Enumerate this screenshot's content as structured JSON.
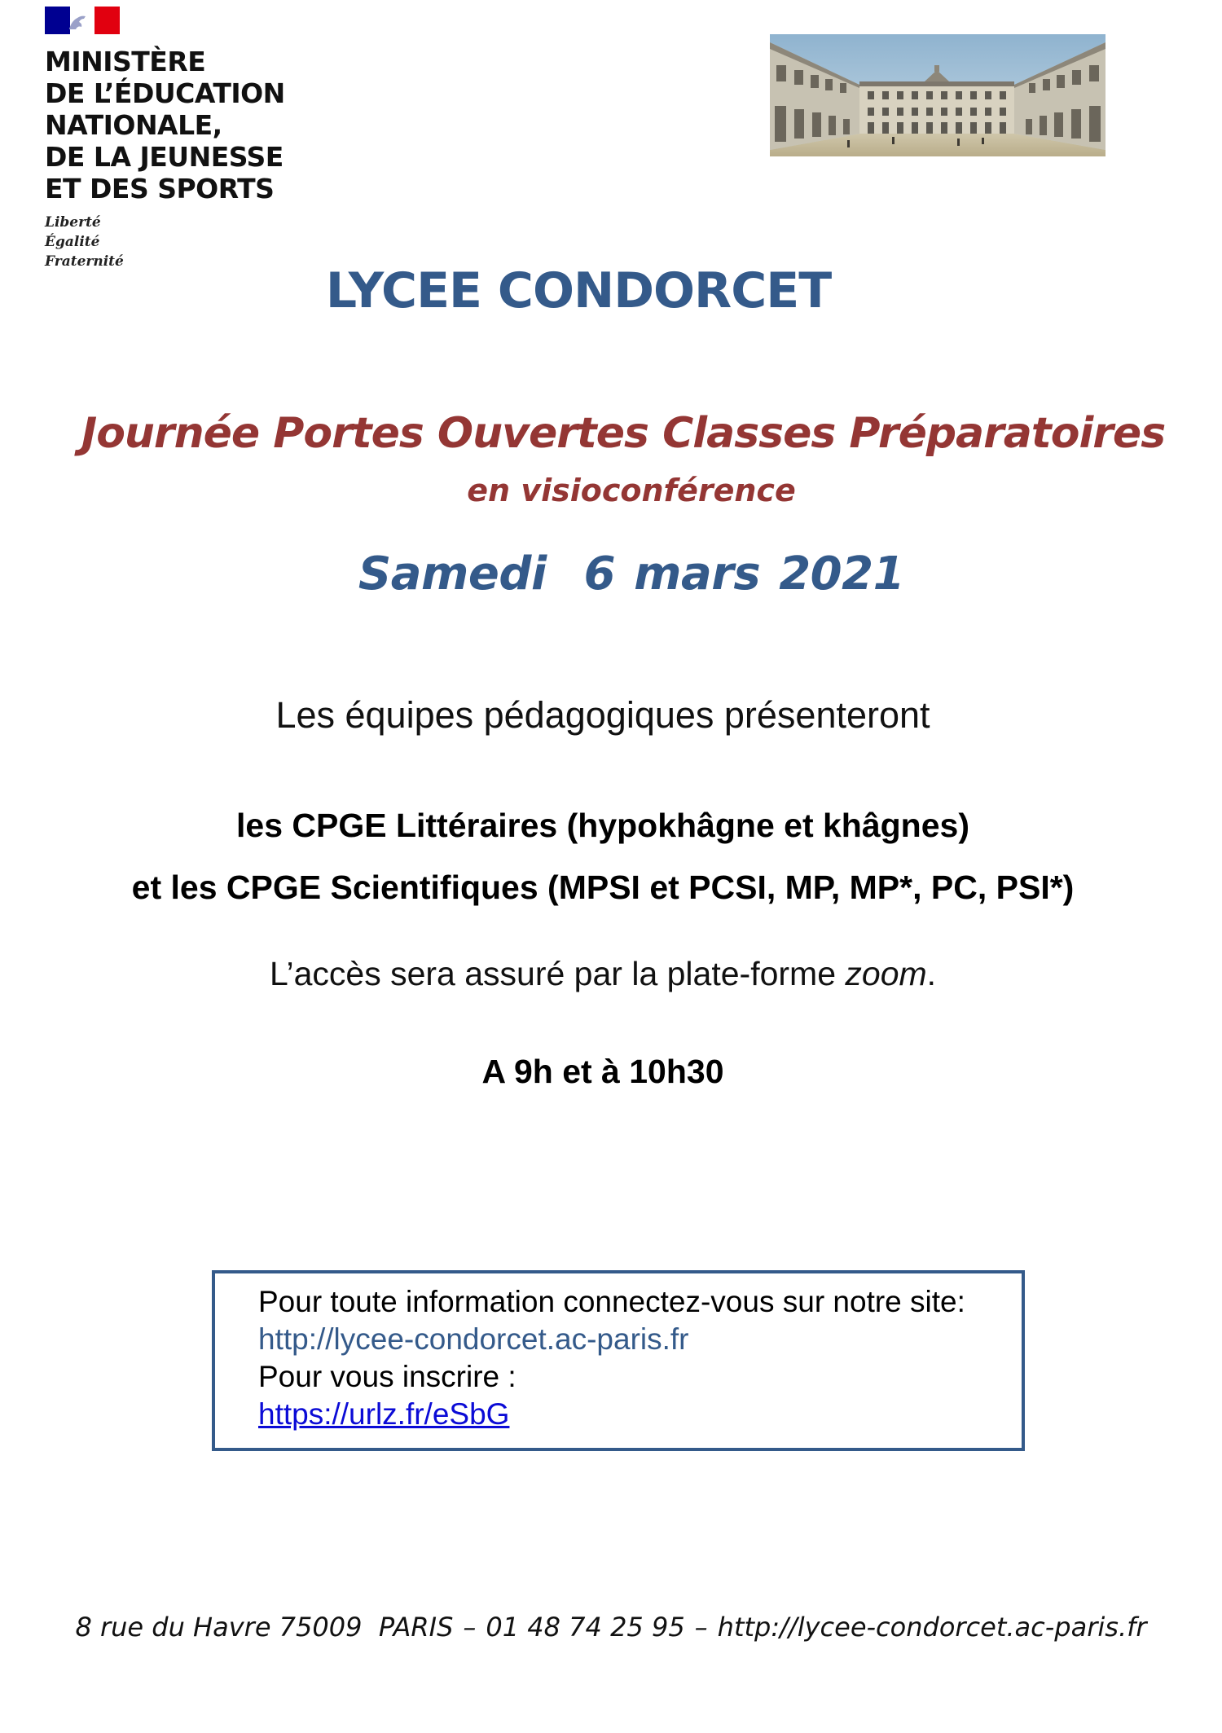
{
  "header": {
    "ministry_lines": [
      "MINISTÈRE",
      "DE L’ÉDUCATION",
      "NATIONALE,",
      "DE LA JEUNESSE",
      "ET DES SPORTS"
    ],
    "motto": [
      "Liberté",
      "Égalité",
      "Fraternité"
    ],
    "flag_colors": {
      "blue": "#000091",
      "white": "#ffffff",
      "red": "#e1000f"
    }
  },
  "title": {
    "school": "LYCEE CONDORCET",
    "event": "Journée Portes Ouvertes Classes Préparatoires",
    "format": "en visioconférence",
    "date": "Samedi  6 mars 2021"
  },
  "body": {
    "intro": "Les équipes pédagogiques présenteront",
    "cpge_literary": "les CPGE Littéraires (hypokhâgne et khâgnes)",
    "cpge_scientific": "et les CPGE Scientifiques (MPSI et PCSI, MP, MP*, PC, PSI*)",
    "access_before": "L’accès sera assuré par la plate-forme ",
    "access_platform": "zoom",
    "access_after": ".",
    "times": "A 9h et à 10h30"
  },
  "info_box": {
    "info_text": "Pour toute information connectez-vous sur notre site:",
    "site_url": "http://lycee-condorcet.ac-paris.fr",
    "register_text": "Pour vous inscrire :",
    "register_url": "https://urlz.fr/eSbG"
  },
  "footer": {
    "address": "8 rue du Havre 75009  PARIS",
    "phone": "01 48 74 25 95",
    "website": "http://lycee-condorcet.ac-paris.fr",
    "separator": "–"
  },
  "colors": {
    "accent_blue": "#345a8a",
    "accent_red": "#943634",
    "link_blue": "#0b0bd6"
  },
  "images": {
    "courtyard": "courtyard-engraving-icon"
  }
}
